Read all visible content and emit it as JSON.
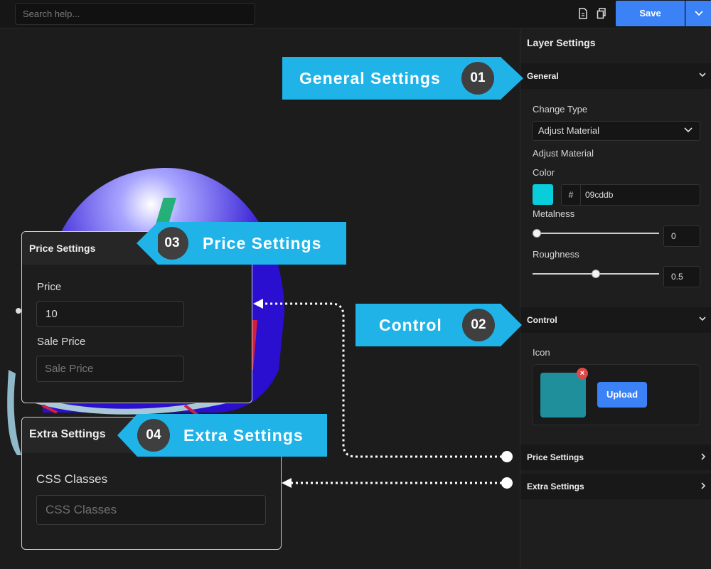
{
  "toolbar": {
    "search_placeholder": "Search help...",
    "save_label": "Save",
    "icons": [
      "document-icon",
      "copy-icon",
      "chevron-down-icon"
    ],
    "save_color": "#3b82f6"
  },
  "panel": {
    "title": "Layer Settings",
    "general": {
      "header": "General",
      "change_type_label": "Change Type",
      "change_type_value": "Adjust Material",
      "adjust_material_label": "Adjust Material",
      "color_label": "Color",
      "hash": "#",
      "color_hex": "09cddb",
      "color_swatch": "#09cddb",
      "metalness_label": "Metalness",
      "metalness_value": "0",
      "metalness_fraction": 0,
      "roughness_label": "Roughness",
      "roughness_value": "0.5",
      "roughness_fraction": 0.5
    },
    "control": {
      "header": "Control",
      "icon_label": "Icon",
      "remove": "×",
      "upload_label": "Upload"
    },
    "price_header": "Price Settings",
    "extra_header": "Extra Settings"
  },
  "price_card": {
    "title": "Price Settings",
    "price_label": "Price",
    "price_value": "10",
    "sale_label": "Sale Price",
    "sale_placeholder": "Sale Price"
  },
  "extra_card": {
    "title": "Extra Settings",
    "css_label": "CSS Classes",
    "css_placeholder": "CSS Classes"
  },
  "callouts": {
    "general": {
      "label": "General Settings",
      "number": "01"
    },
    "control": {
      "label": "Control",
      "number": "02"
    },
    "price": {
      "label": "Price Settings",
      "number": "03"
    },
    "extra": {
      "label": "Extra Settings",
      "number": "04"
    },
    "color": "#1fb3e8"
  }
}
